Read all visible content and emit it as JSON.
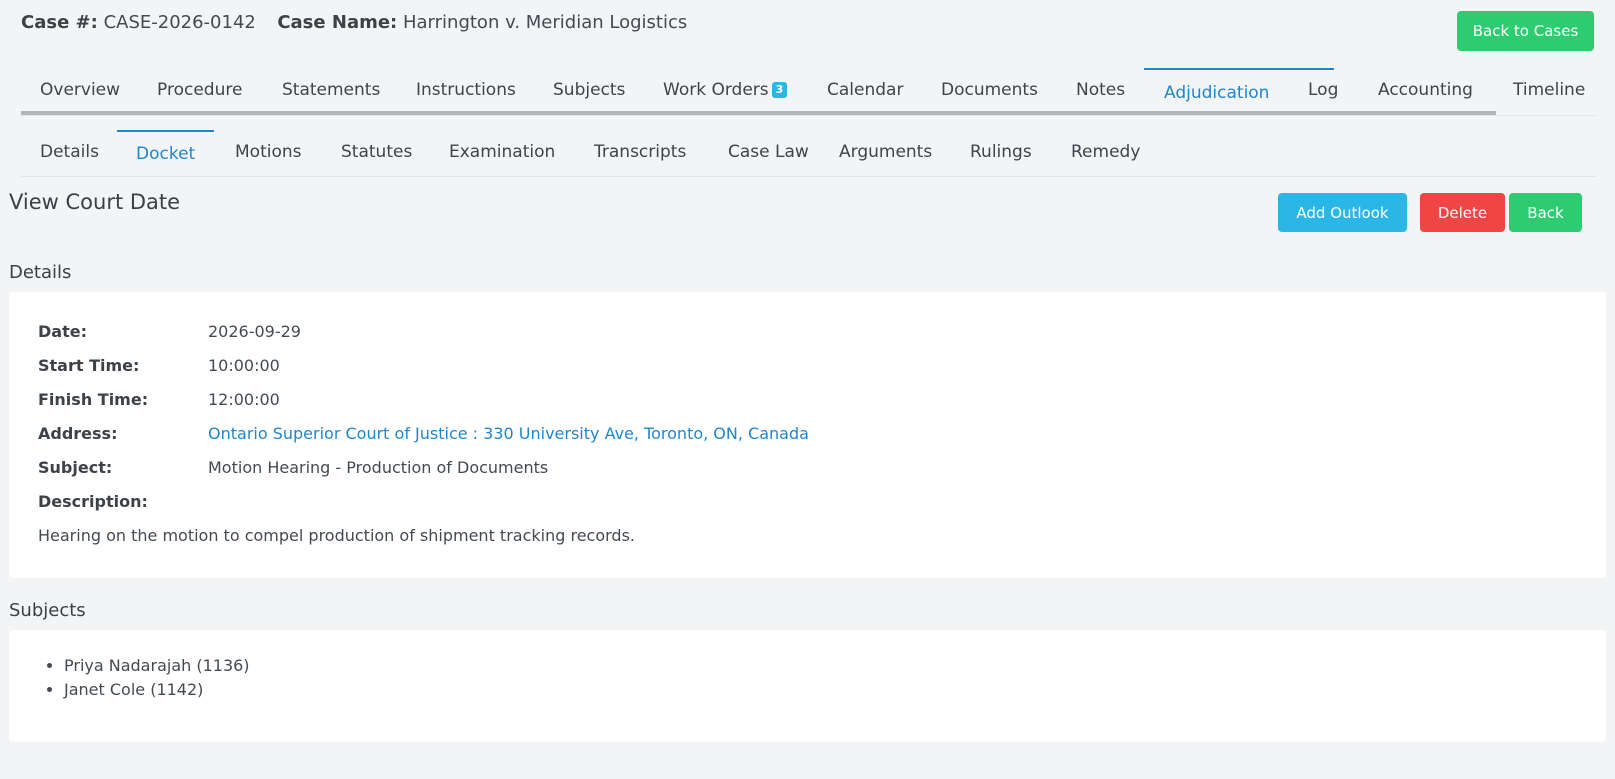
{
  "header": {
    "case_number_label": "Case #:",
    "case_number": "CASE-2026-0142",
    "case_name_label": "Case Name:",
    "case_name": "Harrington v. Meridian Logistics",
    "back_to_cases_label": "Back to Cases"
  },
  "main_tabs": {
    "items": [
      "Overview",
      "Procedure",
      "Statements",
      "Instructions",
      "Subjects",
      "Work Orders",
      "Calendar",
      "Documents",
      "Notes",
      "Adjudication",
      "Log",
      "Accounting",
      "Timeline"
    ],
    "work_orders_badge": "3",
    "active": "Adjudication"
  },
  "sub_tabs": {
    "items": [
      "Details",
      "Docket",
      "Motions",
      "Statutes",
      "Examination",
      "Transcripts",
      "Case Law",
      "Arguments",
      "Rulings",
      "Remedy"
    ],
    "active": "Docket"
  },
  "page": {
    "title": "View Court Date",
    "add_outlook_label": "Add Outlook",
    "delete_label": "Delete",
    "back_label": "Back"
  },
  "details": {
    "section_title": "Details",
    "date_label": "Date:",
    "date": "2026-09-29",
    "start_time_label": "Start Time:",
    "start_time": "10:00:00",
    "finish_time_label": "Finish Time:",
    "finish_time": "12:00:00",
    "address_label": "Address:",
    "address": "Ontario Superior Court of Justice : 330 University Ave, Toronto, ON, Canada",
    "subject_label": "Subject:",
    "subject": "Motion Hearing - Production of Documents",
    "description_label": "Description:",
    "description": "Hearing on the motion to compel production of shipment tracking records."
  },
  "subjects": {
    "section_title": "Subjects",
    "items": [
      "Priya Nadarajah (1136)",
      "Janet Cole (1142)"
    ]
  },
  "colors": {
    "accent_blue": "#1f86cc",
    "green": "#2ecc71",
    "cyan": "#2bb7e6",
    "red": "#f04545"
  }
}
